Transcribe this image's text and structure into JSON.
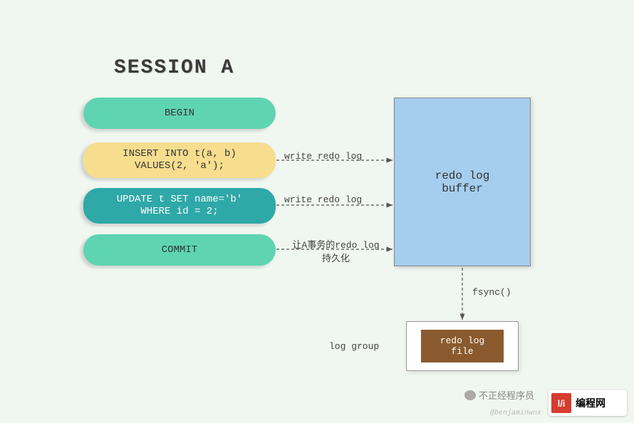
{
  "title": "SESSION A",
  "steps": {
    "begin": "BEGIN",
    "insert": "INSERT INTO t(a, b)\nVALUES(2, 'a');",
    "update": "UPDATE t SET name='b'\nWHERE id = 2;",
    "commit": "COMMIT"
  },
  "arrows": {
    "write1": "write redo log",
    "write2": "write redo log",
    "commit_note": "让A事务的redo log\n持久化",
    "fsync": "fsync()"
  },
  "buffer_label": "redo log\nbuffer",
  "log_group_label": "log group",
  "file_label": "redo log\nfile",
  "branding": {
    "wechat_text": "不正经程序员",
    "logo_text": "编程网",
    "logo_badge": "l/i",
    "watermark": "@benjaminwnx"
  }
}
